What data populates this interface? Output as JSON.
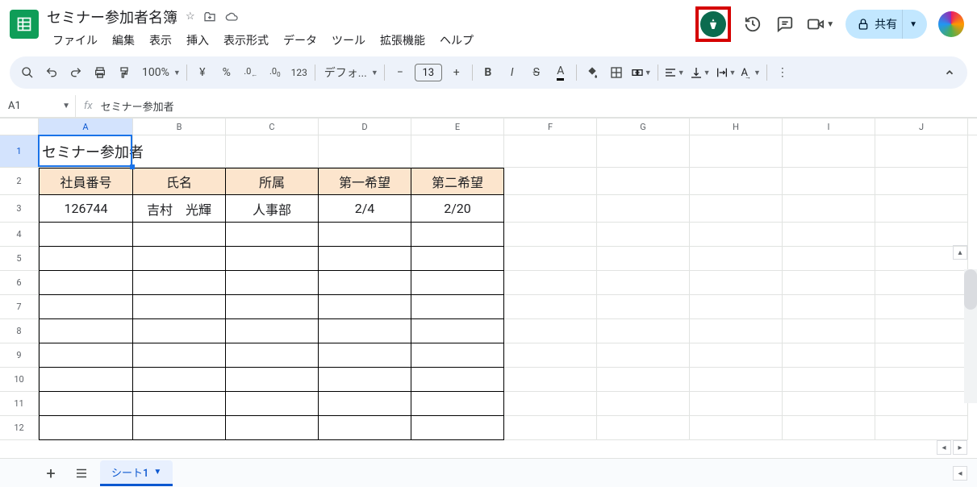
{
  "doc": {
    "title": "セミナー参加者名簿"
  },
  "menus": [
    "ファイル",
    "編集",
    "表示",
    "挿入",
    "表示形式",
    "データ",
    "ツール",
    "拡張機能",
    "ヘルプ"
  ],
  "toolbar": {
    "zoom": "100%",
    "currency": "¥",
    "percent": "%",
    "dec_minus": ".0",
    "dec_plus": ".00",
    "num123": "123",
    "font": "デフォ...",
    "font_size": "13"
  },
  "share": {
    "label": "共有"
  },
  "namebox": "A1",
  "formula": "セミナー参加者",
  "columns": [
    "A",
    "B",
    "C",
    "D",
    "E",
    "F",
    "G",
    "H",
    "I",
    "J"
  ],
  "rows": [
    "1",
    "2",
    "3",
    "4",
    "5",
    "6",
    "7",
    "8",
    "9",
    "10",
    "11",
    "12"
  ],
  "sheet": {
    "a1": "セミナー参加者",
    "headers": [
      "社員番号",
      "氏名",
      "所属",
      "第一希望",
      "第二希望"
    ],
    "row3": [
      "126744",
      "吉村　光輝",
      "人事部",
      "2/4",
      "2/20"
    ]
  },
  "tab": "シート1"
}
